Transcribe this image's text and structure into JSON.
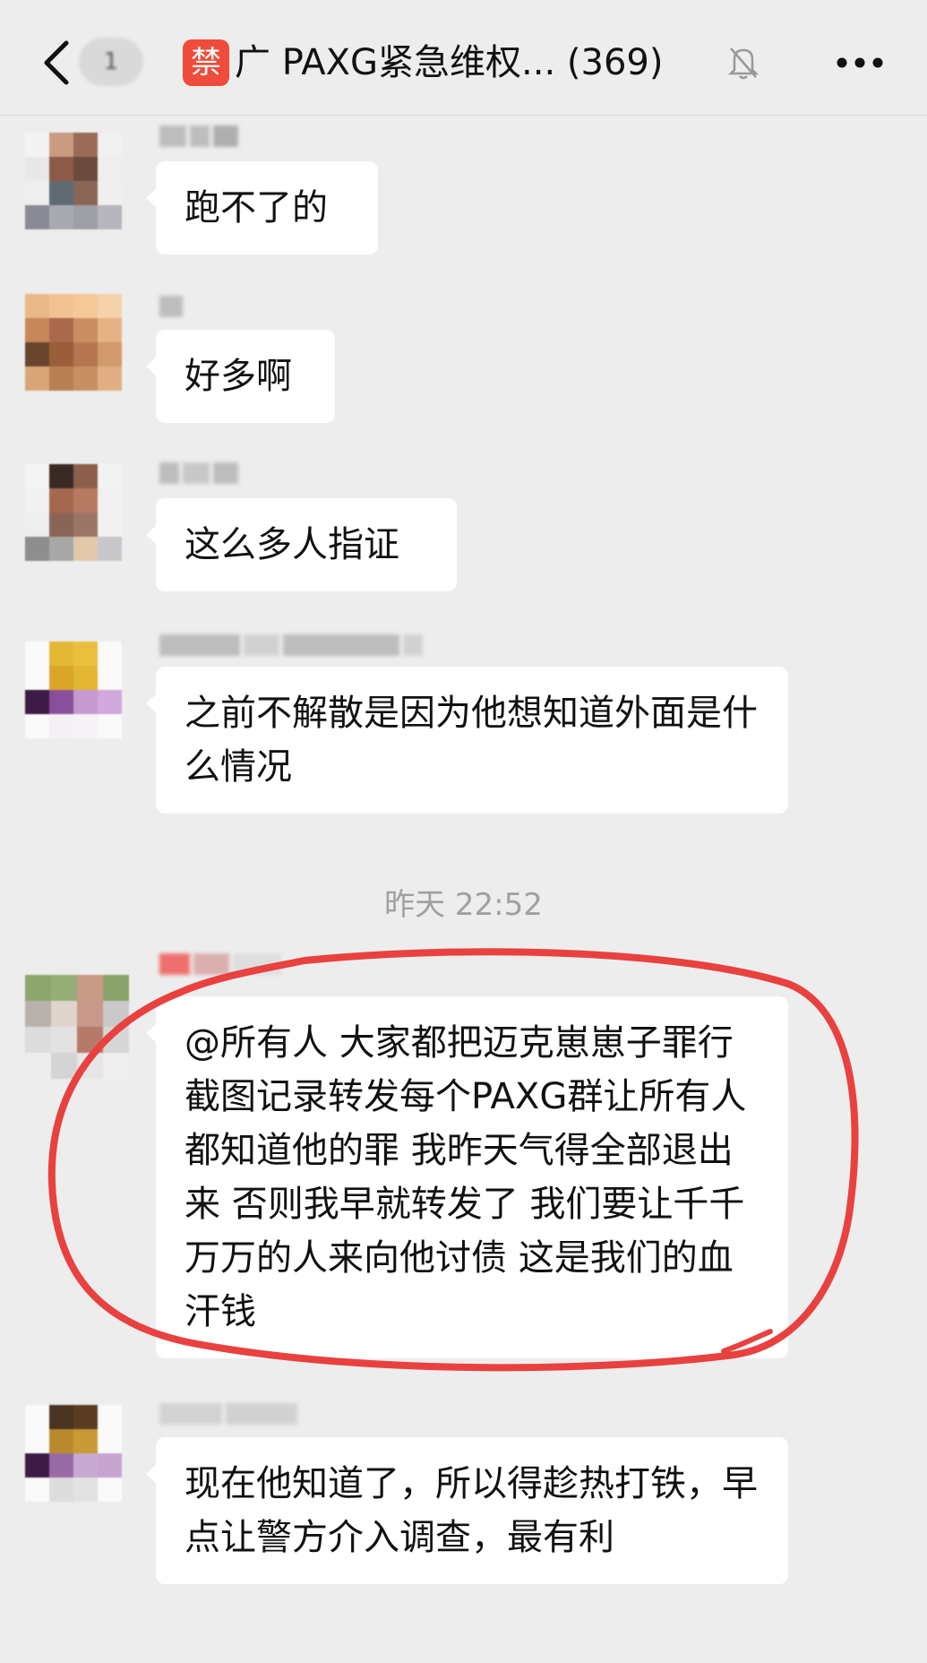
{
  "header": {
    "unread_count": "1",
    "forbid_badge": "禁",
    "title": "广 PAXG紧急维权...  (369)"
  },
  "messages": [
    {
      "text": "跑不了的"
    },
    {
      "text": "好多啊"
    },
    {
      "text": "这么多人指证"
    },
    {
      "text": "之前不解散是因为他想知道外面是什么情况"
    },
    {
      "text": "@所有人  大家都把迈克崽崽子罪行截图记录转发每个PAXG群让所有人都知道他的罪  我昨天气得全部退出来  否则我早就转发了  我们要让千千万万的人来向他讨债  这是我们的血汗钱"
    },
    {
      "text": "现在他知道了，所以得趁热打铁，早点让警方介入调查，最有利"
    }
  ],
  "timestamp": "昨天 22:52",
  "colors": {
    "background": "#ededed",
    "bubble": "#ffffff",
    "highlight": "#e8413f",
    "forbid": "#ef4c3b"
  },
  "icons": [
    "back-icon",
    "mute-bell-icon",
    "more-icon"
  ]
}
